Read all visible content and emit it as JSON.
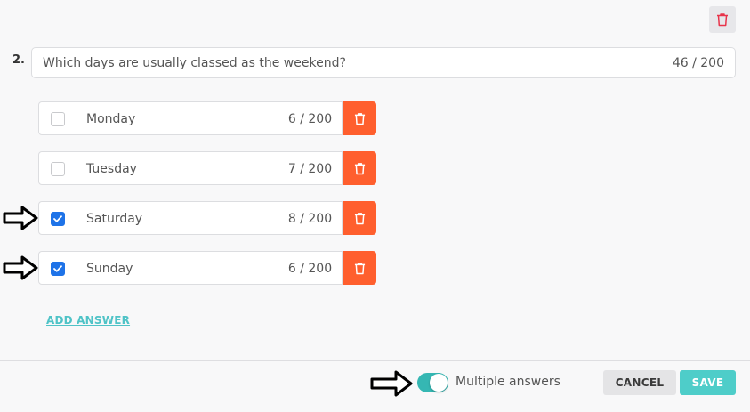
{
  "question": {
    "number": "2.",
    "text": "Which days are usually classed as the weekend?",
    "char_count": "46 / 200"
  },
  "answers": [
    {
      "label": "Monday",
      "char_count": "6 / 200",
      "checked": false
    },
    {
      "label": "Tuesday",
      "char_count": "7 / 200",
      "checked": false
    },
    {
      "label": "Saturday",
      "char_count": "8 / 200",
      "checked": true
    },
    {
      "label": "Sunday",
      "char_count": "6 / 200",
      "checked": true
    }
  ],
  "add_answer_label": "ADD ANSWER",
  "footer": {
    "toggle_label": "Multiple answers",
    "toggle_on": true,
    "cancel_label": "CANCEL",
    "save_label": "SAVE"
  },
  "colors": {
    "delete_orange": "#ff5f2e",
    "checkbox_blue": "#1e73e8",
    "accent_teal": "#4ecdc9",
    "trash_red": "#e8334a"
  },
  "icons": {
    "question_delete": "trash-icon",
    "answer_delete": "trash-icon",
    "checked": "checkmark-icon",
    "annotation": "arrow-right-icon"
  }
}
